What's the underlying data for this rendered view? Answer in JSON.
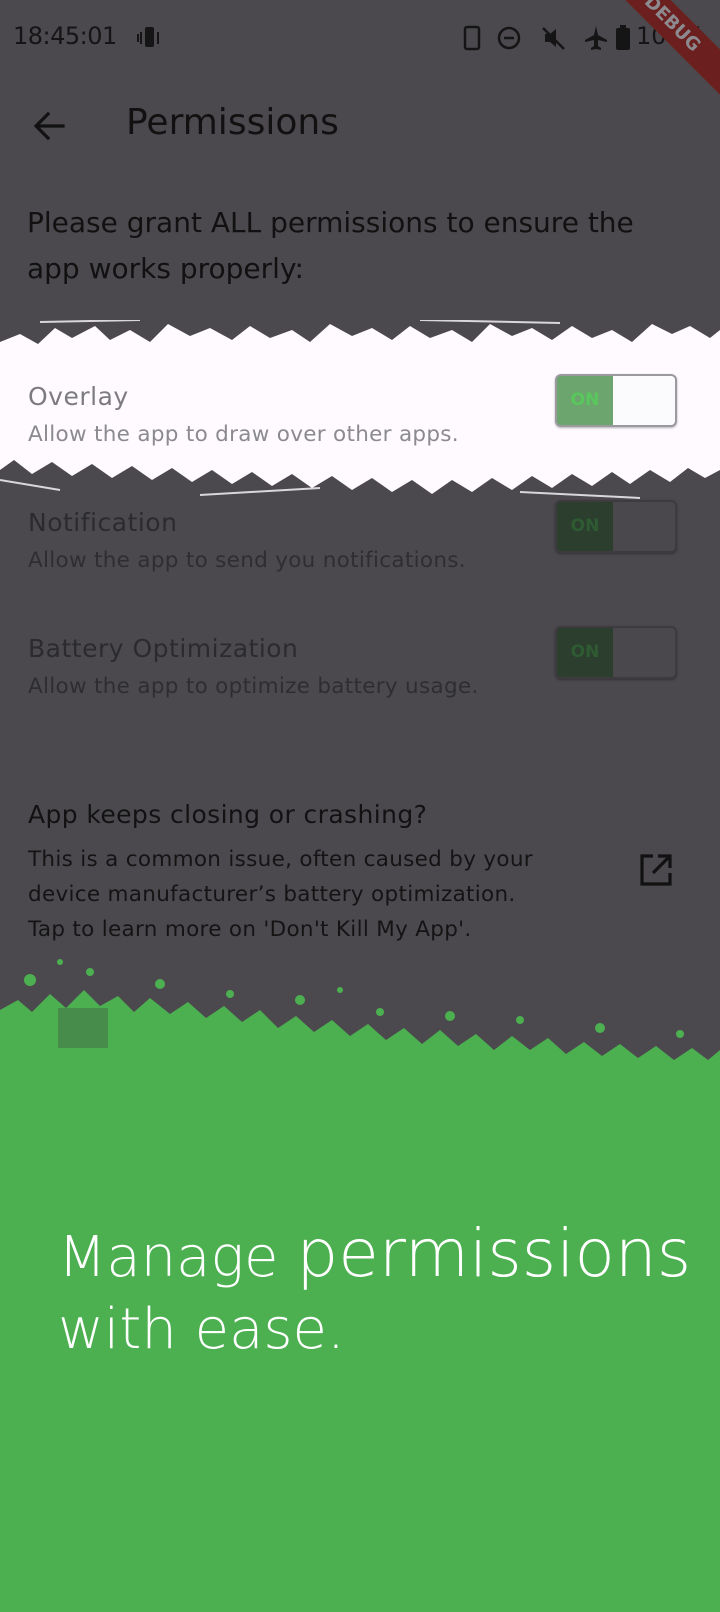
{
  "status_bar": {
    "time": "18:45:01",
    "battery_percent": "100%",
    "icons": [
      "vibrate-icon",
      "phone-icon",
      "do-not-disturb-icon",
      "mute-icon",
      "airplane-icon",
      "battery-icon"
    ],
    "debug_banner": "DEBUG"
  },
  "app_bar": {
    "title": "Permissions"
  },
  "intro_text": "Please grant ALL permissions to ensure the app works properly:",
  "permissions": [
    {
      "title": "Overlay",
      "description": "Allow the app to draw over other apps.",
      "toggle_label": "ON",
      "enabled": true
    },
    {
      "title": "Notification",
      "description": "Allow the app to send you notifications.",
      "toggle_label": "ON",
      "enabled": true
    },
    {
      "title": "Battery Optimization",
      "description": "Allow the app to optimize battery usage.",
      "toggle_label": "ON",
      "enabled": true
    }
  ],
  "crash_help": {
    "title": "App keeps closing or crashing?",
    "body": "This is a common issue, often caused by your\ndevice manufacturer’s battery optimization.\nTap to learn more on 'Don't Kill My App'."
  },
  "promo": {
    "line1_a": "Manage ",
    "line1_b": "permissions",
    "line2": "with ease."
  },
  "colors": {
    "scrim": "#4b494e",
    "accent_green": "#4caf50",
    "highlight": "#fffaff"
  }
}
